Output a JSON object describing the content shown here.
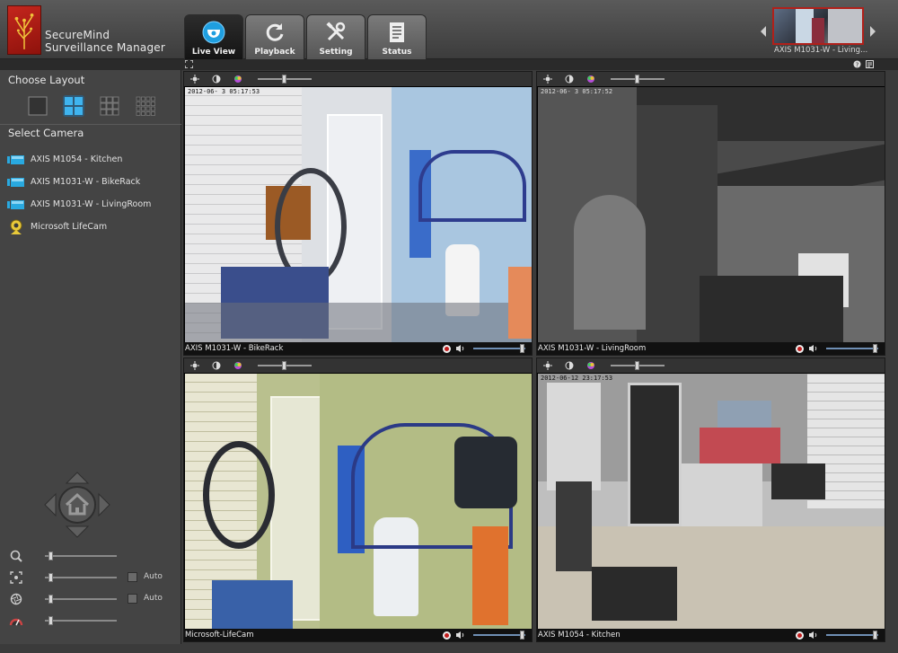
{
  "app": {
    "brand_line1": "SecureMind",
    "brand_line2": "Surveillance Manager"
  },
  "tabs": [
    {
      "label": "Live View",
      "icon": "camera-dome-icon",
      "active": true
    },
    {
      "label": "Playback",
      "icon": "refresh-icon",
      "active": false
    },
    {
      "label": "Setting",
      "icon": "tools-icon",
      "active": false
    },
    {
      "label": "Status",
      "icon": "document-icon",
      "active": false
    }
  ],
  "preview": {
    "label": "AXIS M1031-W - Living..."
  },
  "sidebar": {
    "choose_layout": "Choose Layout",
    "layouts": [
      "1x1",
      "2x2",
      "3x3",
      "4x4"
    ],
    "selected_layout": "2x2",
    "select_camera": "Select Camera",
    "cameras": [
      {
        "label": "AXIS M1054 - Kitchen",
        "icon": "ip-camera-icon"
      },
      {
        "label": "AXIS M1031-W - BikeRack",
        "icon": "ip-camera-icon"
      },
      {
        "label": "AXIS M1031-W - LivingRoom",
        "icon": "ip-camera-icon"
      },
      {
        "label": "Microsoft LifeCam",
        "icon": "webcam-icon"
      }
    ],
    "controls": [
      {
        "icon": "zoom-icon",
        "auto": false,
        "auto_label": "",
        "level": 0.05
      },
      {
        "icon": "focus-icon",
        "auto": true,
        "auto_label": "Auto",
        "level": 0.05
      },
      {
        "icon": "iris-icon",
        "auto": true,
        "auto_label": "Auto",
        "level": 0.05
      },
      {
        "icon": "speed-icon",
        "auto": false,
        "auto_label": "",
        "level": 0.05
      }
    ]
  },
  "panels": [
    {
      "name": "AXIS M1031-W - BikeRack",
      "timestamp": "2012-06-   3 05:17:53"
    },
    {
      "name": "AXIS M1031-W - LivingRoom",
      "timestamp": "2012-06-   3 05:17:52"
    },
    {
      "name": "Microsoft-LifeCam",
      "timestamp": ""
    },
    {
      "name": "AXIS M1054 - Kitchen",
      "timestamp": "2012-06-12 23:17:53"
    }
  ],
  "colors": {
    "accent": "#29a9e0",
    "record": "#c21d1d",
    "logo": "#c4261d"
  }
}
